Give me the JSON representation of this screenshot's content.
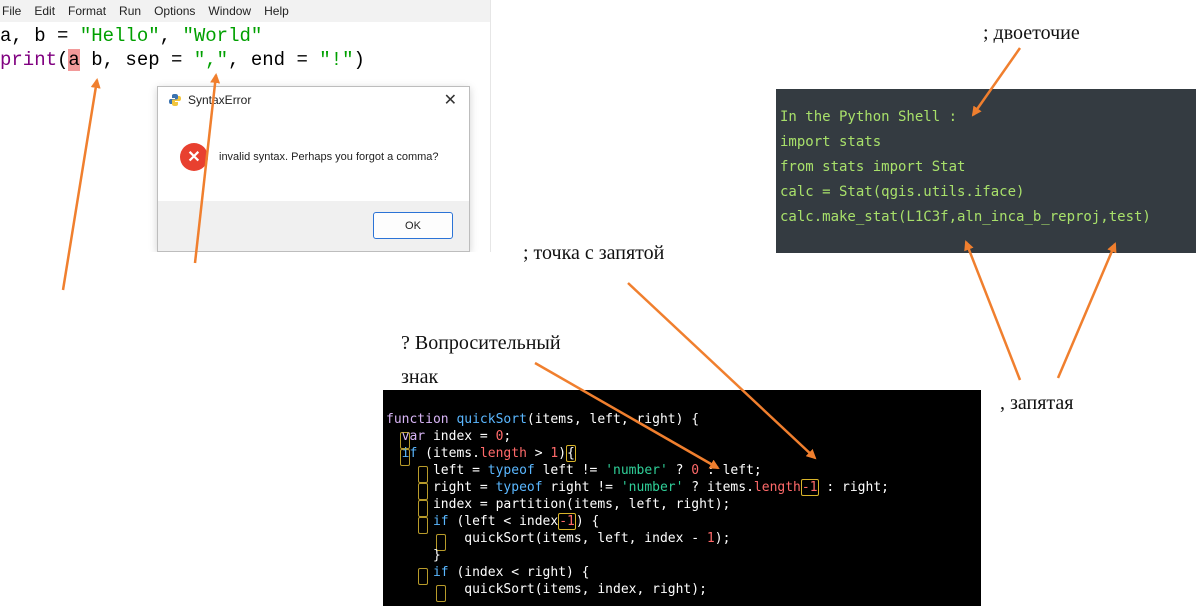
{
  "idle": {
    "menu": [
      "File",
      "Edit",
      "Format",
      "Run",
      "Options",
      "Window",
      "Help"
    ],
    "line1": {
      "a": "a, b = ",
      "s1": "\"Hello\"",
      "sep": ", ",
      "s2": "\"World\""
    },
    "line2": {
      "print": "print",
      "open": "(",
      "hl": "a",
      "rest": " b, sep = ",
      "s1": "\",\"",
      "mid": ", end = ",
      "s2": "\"!\"",
      "close": ")"
    },
    "dialog": {
      "title": "SyntaxError",
      "close": "✕",
      "message": "invalid syntax. Perhaps you forgot a comma?",
      "ok": "OK"
    }
  },
  "shell": {
    "lines": [
      "In the Python Shell :",
      "import stats",
      "from stats import Stat",
      "calc = Stat(qgis.utils.iface)",
      "calc.make_stat(L1C3f,aln_inca_b_reproj,test)"
    ]
  },
  "annotations": {
    "colon": "; двоеточие",
    "semicolon": "; точка с запятой",
    "question_line1": "? Вопросительный",
    "question_line2": "знак",
    "comma": ", запятая"
  },
  "js": {
    "l1": {
      "k": "function ",
      "fn": "quickSort",
      "rest": "(items, left, right) {"
    },
    "l2": {
      "k": "var ",
      "rest": "index = ",
      "n": "0",
      "end": ";"
    },
    "l3": {
      "k": "if ",
      "a": "(items.",
      "prop": "length",
      "b": " > ",
      "n": "1",
      "c": ")",
      "d": "{"
    },
    "l4": {
      "a": "left = ",
      "k": "typeof ",
      "b": "left != ",
      "s": "'number'",
      "c": " ? ",
      "n": "0",
      "d": " : left;"
    },
    "l5": {
      "a": "right = ",
      "k": "typeof ",
      "b": "right != ",
      "s": "'number'",
      "c": " ? items.",
      "prop": "length",
      "n": "-1",
      "d": " : right;"
    },
    "l6": {
      "a": "index = partition(items, left, right);"
    },
    "l7": {
      "k": "if ",
      "a": "(left < index",
      "n": "-1",
      "b": ") {"
    },
    "l8": {
      "a": "quickSort(items, left, index - ",
      "n": "1",
      "b": ");"
    },
    "l9": {
      "a": "}"
    },
    "l10": {
      "k": "if ",
      "a": "(index < right) {"
    },
    "l11": {
      "a": "quickSort(items, index, right);"
    }
  },
  "colors": {
    "arrow": "#f07f2e",
    "shell_bg": "#343b41",
    "shell_text": "#a8e06a",
    "code_bg": "#000000",
    "error_red": "#e8402f"
  }
}
